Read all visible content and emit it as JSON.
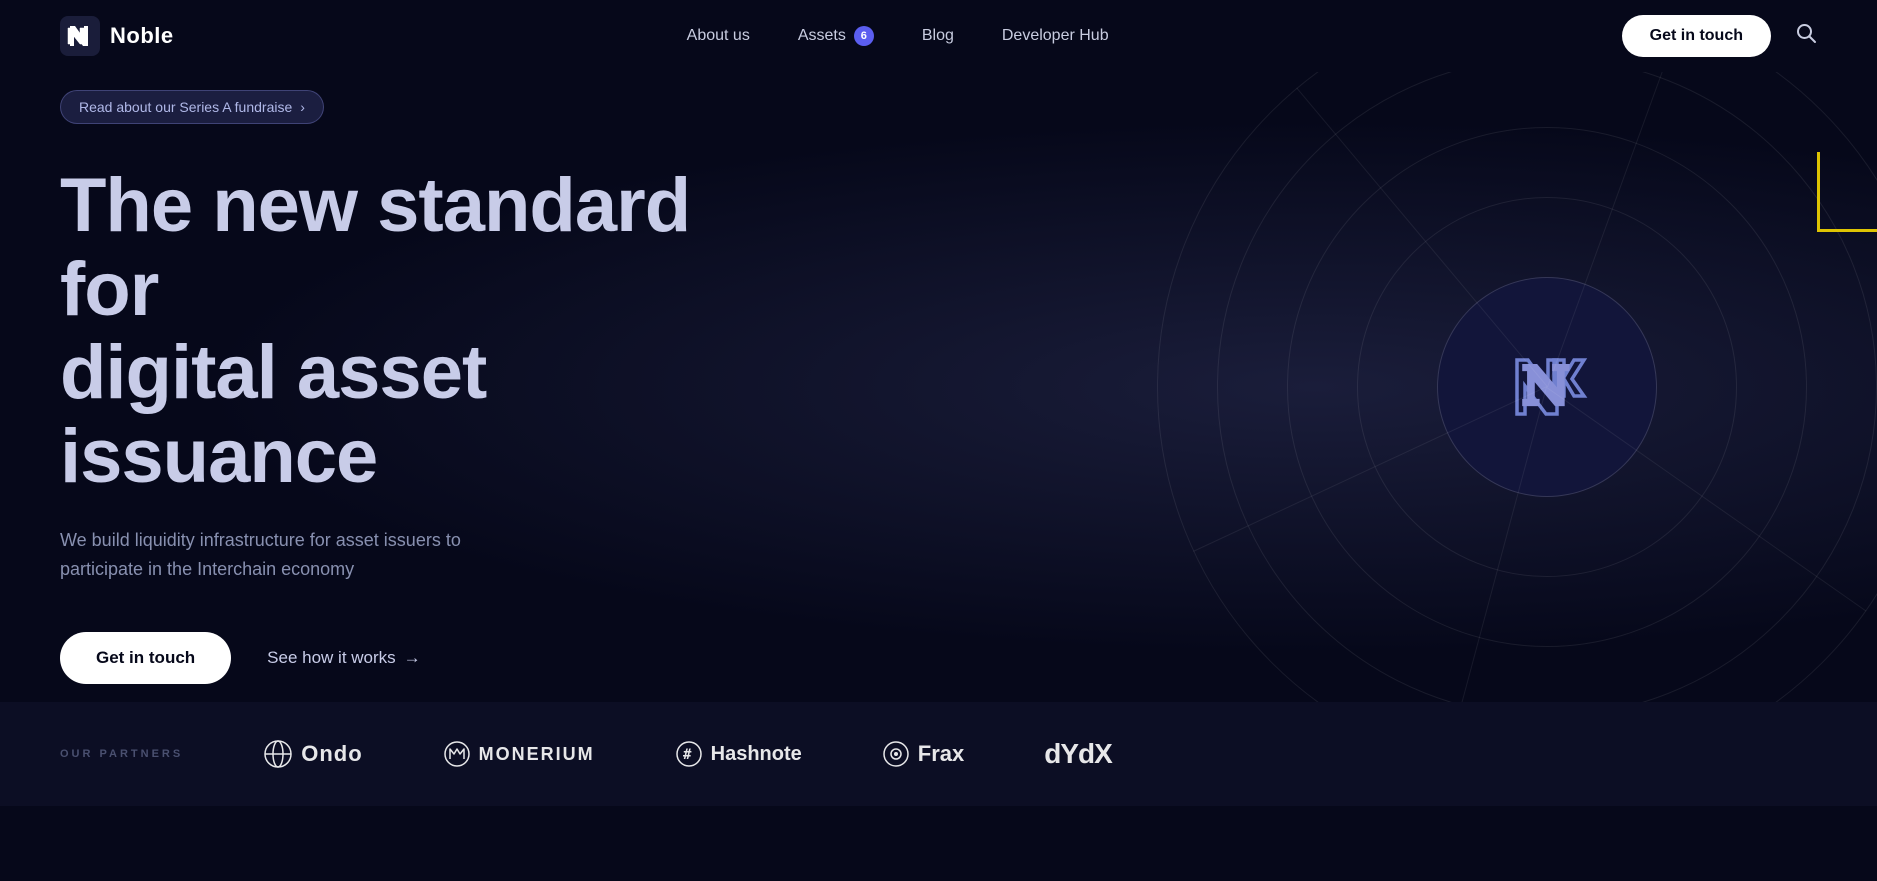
{
  "nav": {
    "logo_text": "Noble",
    "links": [
      {
        "label": "About us",
        "id": "about-us"
      },
      {
        "label": "Assets",
        "id": "assets",
        "badge": "6"
      },
      {
        "label": "Blog",
        "id": "blog"
      },
      {
        "label": "Developer Hub",
        "id": "developer-hub"
      }
    ],
    "cta_label": "Get in touch",
    "search_label": "Search"
  },
  "hero": {
    "badge_text": "Read about our Series A fundraise",
    "badge_arrow": "›",
    "title_line1": "The new standard for",
    "title_line2": "digital asset issuance",
    "subtitle": "We build liquidity infrastructure for asset issuers to participate in the Interchain economy",
    "cta_label": "Get in touch",
    "link_label": "See how it works",
    "link_arrow": "→"
  },
  "partners": {
    "section_label": "OUR PARTNERS",
    "logos": [
      {
        "name": "Ondo",
        "id": "ondo"
      },
      {
        "name": "MONERIUM",
        "id": "monerium"
      },
      {
        "name": "Hashnote",
        "id": "hashnote"
      },
      {
        "name": "Frax",
        "id": "frax"
      },
      {
        "name": "dYdX",
        "id": "dydx"
      }
    ]
  },
  "colors": {
    "bg": "#06081a",
    "nav_bg": "#06081a",
    "partners_bg": "#0c0e24",
    "accent_purple": "#5b5ef0",
    "accent_yellow": "#f5d800",
    "text_primary": "#c8cce8",
    "text_muted": "#8890b0"
  }
}
